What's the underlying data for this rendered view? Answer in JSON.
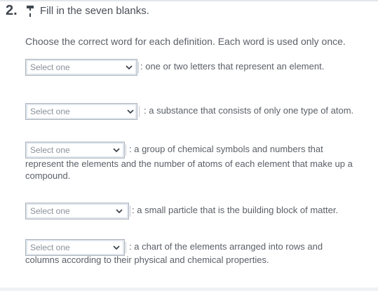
{
  "question": {
    "number": "2.",
    "icon": "pencil-icon",
    "title": "Fill in the seven blanks.",
    "instructions": "Choose the correct word for each definition. Each word is used only once."
  },
  "items": [
    {
      "dropdown": {
        "value": "Select one",
        "icon": "chevron-down-icon"
      },
      "definition_line1": ": one or two letters that represent an element.",
      "definition_rest": ""
    },
    {
      "dropdown": {
        "value": "Select one",
        "icon": "chevron-down-icon"
      },
      "definition_line1": ": a substance that consists of only one type of atom.",
      "definition_rest": ""
    },
    {
      "dropdown": {
        "value": "Select one",
        "icon": "chevron-down-icon"
      },
      "definition_line1": ": a group of chemical symbols and numbers that",
      "definition_rest": "represent the elements and the number of atoms of each element that make up a compound."
    },
    {
      "dropdown": {
        "value": "Select one",
        "icon": "chevron-down-icon"
      },
      "definition_line1": ": a small particle that is the building block of matter.",
      "definition_rest": ""
    },
    {
      "dropdown": {
        "value": "Select one",
        "icon": "chevron-down-icon"
      },
      "definition_line1": ": a chart of the elements arranged into rows and",
      "definition_rest": "columns according to their physical and chemical properties."
    }
  ],
  "colors": {
    "text": "#5a5f66",
    "dropdown_border": "#aeb4bb",
    "dropdown_inner": "#dfe6ee"
  }
}
